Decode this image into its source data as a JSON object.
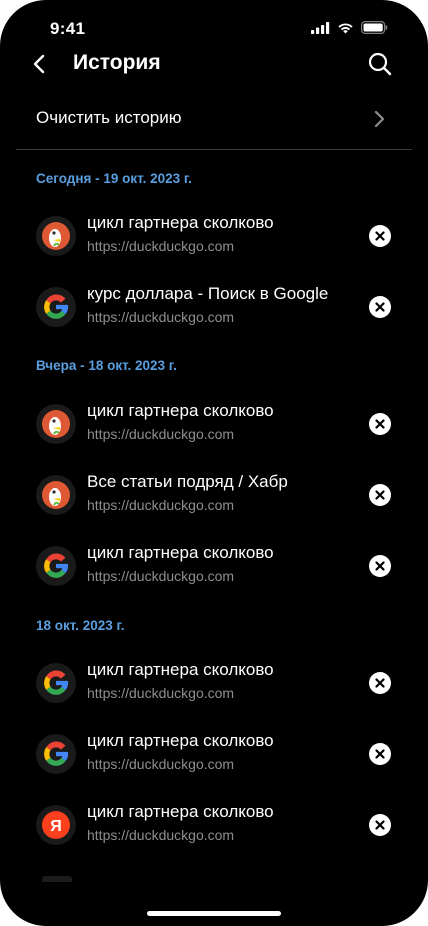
{
  "status_bar": {
    "time": "9:41"
  },
  "header": {
    "title": "История"
  },
  "clear": {
    "label": "Очистить историю"
  },
  "sections": [
    {
      "label": "Сегодня - 19 окт. 2023 г.",
      "items": [
        {
          "title": "цикл гартнера сколково",
          "url": "https://duckduckgo.com",
          "icon": "duckduckgo-icon"
        },
        {
          "title": "курс доллара - Поиск в Google",
          "url": "https://duckduckgo.com",
          "icon": "google-icon"
        }
      ]
    },
    {
      "label": "Вчера - 18 окт. 2023 г.",
      "items": [
        {
          "title": "цикл гартнера сколково",
          "url": "https://duckduckgo.com",
          "icon": "duckduckgo-icon"
        },
        {
          "title": "Все статьи подряд / Хабр",
          "url": "https://duckduckgo.com",
          "icon": "duckduckgo-icon"
        },
        {
          "title": "цикл гартнера сколково",
          "url": "https://duckduckgo.com",
          "icon": "google-icon"
        }
      ]
    },
    {
      "label": "18 окт. 2023 г.",
      "items": [
        {
          "title": "цикл гартнера сколково",
          "url": "https://duckduckgo.com",
          "icon": "google-icon"
        },
        {
          "title": "цикл гартнера сколково",
          "url": "https://duckduckgo.com",
          "icon": "google-icon"
        },
        {
          "title": "цикл гартнера сколково",
          "url": "https://duckduckgo.com",
          "icon": "yandex-icon"
        }
      ]
    }
  ],
  "yandex_letter": "Я"
}
